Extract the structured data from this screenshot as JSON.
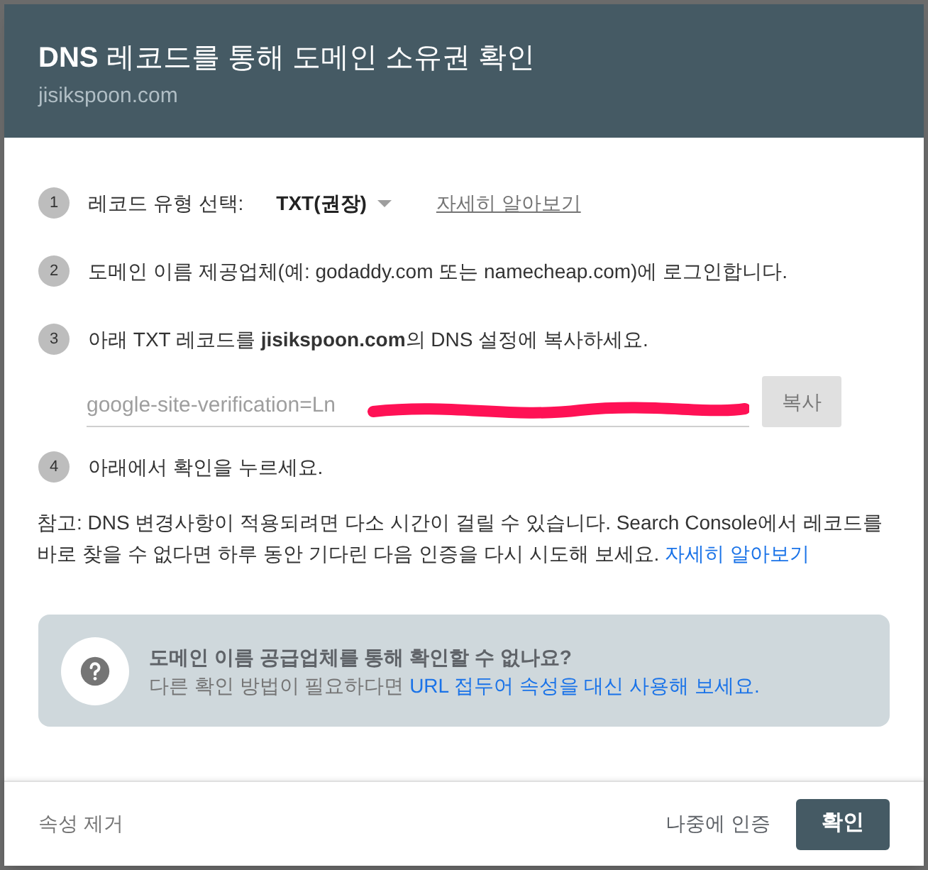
{
  "dialog": {
    "title_bold": "DNS",
    "title": "레코드를 통해 도메인 소유권 확인",
    "subtitle": "jisikspoon.com"
  },
  "steps": [
    {
      "kind": "select",
      "number": "1",
      "label": "레코드 유형 선택:",
      "value": "TXT(권장)",
      "link": "자세히 알아보기"
    },
    {
      "kind": "text",
      "number": "2",
      "text": "도메인 이름 제공업체(예: godaddy.com 또는 namecheap.com)에 로그인합니다."
    },
    {
      "kind": "copy",
      "number": "3",
      "text": "아래 TXT 레코드를 **jisikspoon.com**의 DNS 설정에 복사하세요.",
      "field_value": "google-site-verification=Ln",
      "redacted": true,
      "button": "복사"
    },
    {
      "kind": "text",
      "number": "4",
      "text": "아래에서 확인을 누르세요."
    }
  ],
  "note": {
    "text": "참고: DNS 변경사항이 적용되려면 다소 시간이 걸릴 수 있습니다. Search Console에서 레코드를 바로 찾을 수 없다면 하루 동안 기다린 다음 인증을 다시 시도해 보세요.",
    "link": "자세히 알아보기"
  },
  "help_box": {
    "title": "도메인 이름 공급업체를 통해 확인할 수 없나요?",
    "text": "다른 확인 방법이 필요하다면",
    "link": "URL 접두어 속성을 대신 사용해 보세요."
  },
  "footer": {
    "left_button": "속성 제거",
    "secondary_button": "나중에 인증",
    "primary_button": "확인"
  }
}
